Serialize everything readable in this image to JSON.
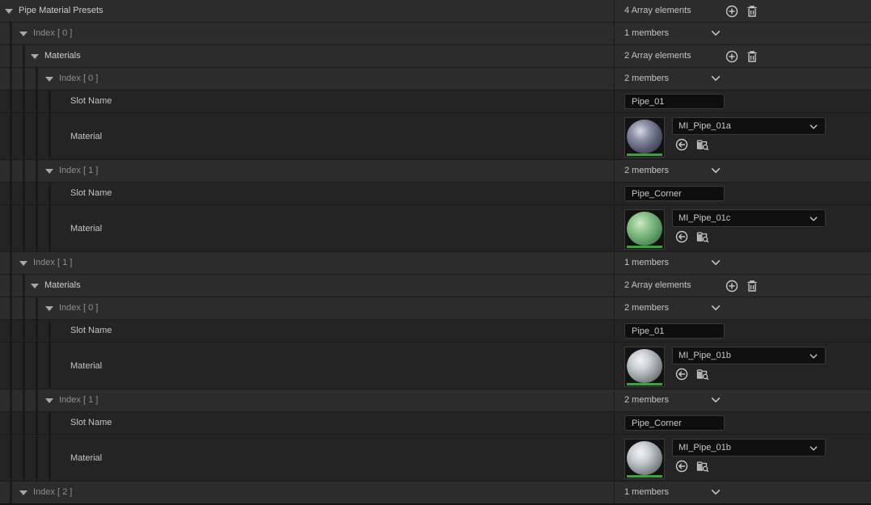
{
  "colors": {
    "background": "#151515",
    "row": "#242424",
    "header_row": "#2c2c2c",
    "text": "#c4c4c4",
    "dim_text": "#8e8e8e",
    "thumbnail_bar": "#3aa63a"
  },
  "icons": {
    "expand": "triangle-down-icon",
    "dropdown": "chevron-down-icon",
    "add": "plus-circle-icon",
    "delete": "trash-icon",
    "use_selected": "arrow-left-circle-icon",
    "browse": "folder-search-icon"
  },
  "rows": [
    {
      "kind": "array",
      "name": "pipe-material-presets",
      "label": "Pipe Material Presets",
      "value": "4 Array elements",
      "depth": 0
    },
    {
      "kind": "index",
      "name": "preset-index-0",
      "label": "Index [ 0 ]",
      "value": "1 members",
      "depth": 1
    },
    {
      "kind": "array",
      "name": "preset-0-materials",
      "label": "Materials",
      "value": "2 Array elements",
      "depth": 2
    },
    {
      "kind": "index",
      "name": "preset-0-material-index-0",
      "label": "Index [ 0 ]",
      "value": "2 members",
      "depth": 3
    },
    {
      "kind": "slot",
      "name": "preset-0-material-0-slot-name",
      "label": "Slot Name",
      "value": "Pipe_01",
      "depth": 4
    },
    {
      "kind": "material",
      "name": "preset-0-material-0-material",
      "label": "Material",
      "value": "MI_Pipe_01a",
      "depth": 4,
      "thumb": "blue"
    },
    {
      "kind": "index",
      "name": "preset-0-material-index-1",
      "label": "Index [ 1 ]",
      "value": "2 members",
      "depth": 3
    },
    {
      "kind": "slot",
      "name": "preset-0-material-1-slot-name",
      "label": "Slot Name",
      "value": "Pipe_Corner",
      "depth": 4
    },
    {
      "kind": "material",
      "name": "preset-0-material-1-material",
      "label": "Material",
      "value": "MI_Pipe_01c",
      "depth": 4,
      "thumb": "green"
    },
    {
      "kind": "index",
      "name": "preset-index-1",
      "label": "Index [ 1 ]",
      "value": "1 members",
      "depth": 1
    },
    {
      "kind": "array",
      "name": "preset-1-materials",
      "label": "Materials",
      "value": "2 Array elements",
      "depth": 2
    },
    {
      "kind": "index",
      "name": "preset-1-material-index-0",
      "label": "Index [ 0 ]",
      "value": "2 members",
      "depth": 3
    },
    {
      "kind": "slot",
      "name": "preset-1-material-0-slot-name",
      "label": "Slot Name",
      "value": "Pipe_01",
      "depth": 4
    },
    {
      "kind": "material",
      "name": "preset-1-material-0-material",
      "label": "Material",
      "value": "MI_Pipe_01b",
      "depth": 4,
      "thumb": "grey"
    },
    {
      "kind": "index",
      "name": "preset-1-material-index-1",
      "label": "Index [ 1 ]",
      "value": "2 members",
      "depth": 3
    },
    {
      "kind": "slot",
      "name": "preset-1-material-1-slot-name",
      "label": "Slot Name",
      "value": "Pipe_Corner",
      "depth": 4
    },
    {
      "kind": "material",
      "name": "preset-1-material-1-material",
      "label": "Material",
      "value": "MI_Pipe_01b",
      "depth": 4,
      "thumb": "grey"
    },
    {
      "kind": "index",
      "name": "preset-index-2",
      "label": "Index [ 2 ]",
      "value": "1 members",
      "depth": 1
    }
  ]
}
